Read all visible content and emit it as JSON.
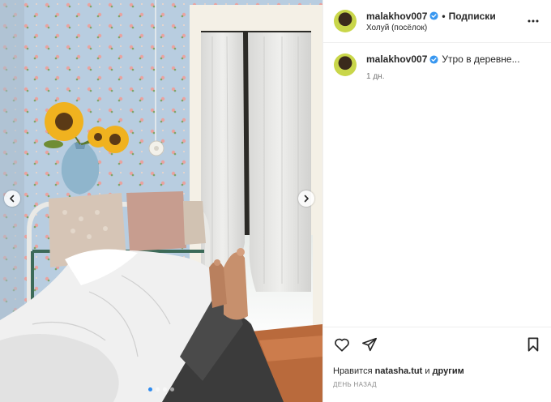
{
  "header": {
    "username": "malakhov007",
    "separator": "•",
    "follow_label": "Подписки",
    "location": "Холуй (посёлок)"
  },
  "caption": {
    "username": "malakhov007",
    "text": "Утро в деревне...",
    "time": "1 дн."
  },
  "likes": {
    "prefix": "Нравится",
    "user": "natasha.tut",
    "and": "и",
    "others": "другим"
  },
  "post_date": "ДЕНЬ НАЗАД",
  "carousel": {
    "slides": 4,
    "active_slide": 1
  },
  "icons": [
    "chevron-left-icon",
    "chevron-right-icon",
    "verified-badge-icon",
    "more-icon",
    "heart-icon",
    "share-icon",
    "bookmark-icon"
  ],
  "colors": {
    "verified": "#3897f0",
    "active_dot": "#2f8cf0",
    "text": "#262626",
    "muted": "#737373"
  }
}
